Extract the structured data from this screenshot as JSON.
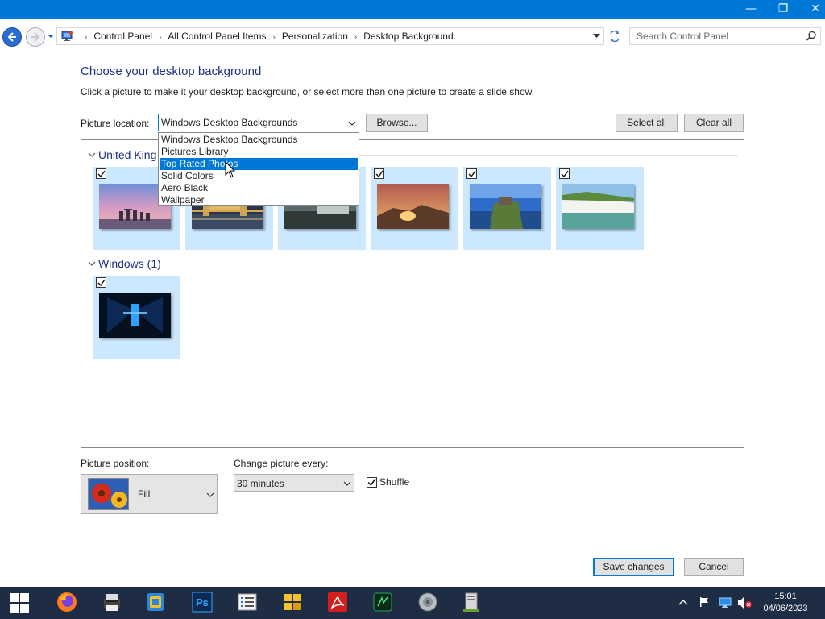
{
  "window": {
    "minimize_glyph": "—",
    "restore_glyph": "❐",
    "close_glyph": "✕"
  },
  "address": {
    "breadcrumbs": [
      "Control Panel",
      "All Control Panel Items",
      "Personalization",
      "Desktop Background"
    ],
    "separator": "›",
    "search_placeholder": "Search Control Panel"
  },
  "content": {
    "heading": "Choose your desktop background",
    "subtext": "Click a picture to make it your desktop background, or select more than one picture to create a slide show.",
    "picture_location_label": "Picture location:",
    "picture_location_value": "Windows Desktop Backgrounds",
    "browse_label": "Browse...",
    "select_all_label": "Select all",
    "clear_all_label": "Clear all",
    "location_options": [
      {
        "label": "Windows Desktop Backgrounds",
        "selected": false
      },
      {
        "label": "Pictures Library",
        "selected": false
      },
      {
        "label": "Top Rated Photos",
        "selected": true
      },
      {
        "label": "Solid Colors",
        "selected": false
      },
      {
        "label": "Aero Black",
        "selected": false
      },
      {
        "label": "Wallpaper",
        "selected": false
      }
    ],
    "groups": [
      {
        "title": "United Kingdom (6)",
        "visible_title": "United King",
        "count": 6
      },
      {
        "title": "Windows (1)",
        "count": 1
      }
    ],
    "picture_position_label": "Picture position:",
    "picture_position_value": "Fill",
    "change_picture_label": "Change picture every:",
    "change_picture_value": "30 minutes",
    "shuffle_label": "Shuffle",
    "shuffle_checked": true,
    "save_label": "Save changes",
    "cancel_label": "Cancel"
  },
  "taskbar": {
    "apps": [
      "firefox-icon",
      "printer-icon",
      "virtualbox-icon",
      "photoshop-icon",
      "notepad-list-icon",
      "network-tool-icon",
      "acrobat-icon",
      "gpu-z-icon",
      "speaker-icon",
      "file-server-icon"
    ],
    "photoshop_text": "Ps",
    "time": "15:01",
    "date": "04/06/2023"
  },
  "colors": {
    "accent": "#0078d7",
    "tile_selected": "#cce8ff",
    "heading": "#1e3287",
    "taskbar": "#1f2d44"
  }
}
